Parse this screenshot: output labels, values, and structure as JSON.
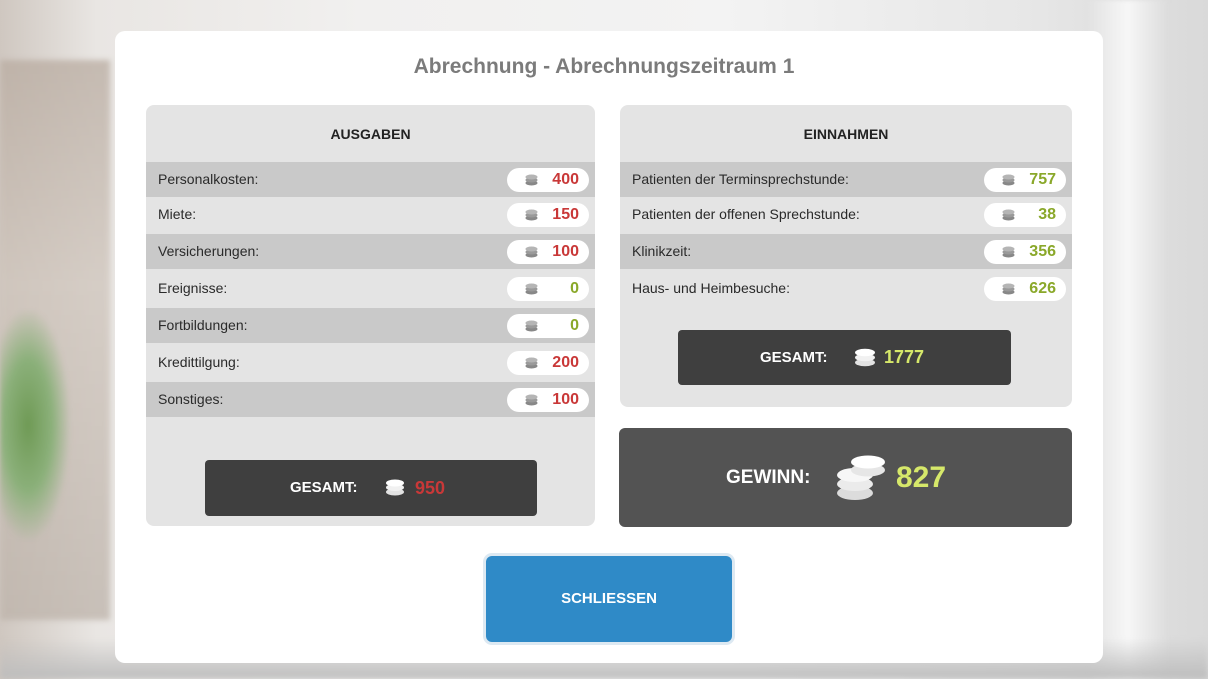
{
  "dialog": {
    "title": "Abrechnung - Abrechnungszeitraum 1",
    "close_label": "SCHLIESSEN"
  },
  "expenses": {
    "heading": "AUSGABEN",
    "items": [
      {
        "label": "Personalkosten:",
        "value": "400"
      },
      {
        "label": "Miete:",
        "value": "150"
      },
      {
        "label": "Versicherungen:",
        "value": "100"
      },
      {
        "label": "Ereignisse:",
        "value": "0"
      },
      {
        "label": "Fortbildungen:",
        "value": "0"
      },
      {
        "label": "Kredittilgung:",
        "value": "200"
      },
      {
        "label": "Sonstiges:",
        "value": "100"
      }
    ],
    "total_label": "GESAMT:",
    "total_value": "950"
  },
  "income": {
    "heading": "EINNAHMEN",
    "items": [
      {
        "label": "Patienten der Terminsprechstunde:",
        "value": "757"
      },
      {
        "label": "Patienten der offenen Sprechstunde:",
        "value": "38"
      },
      {
        "label": "Klinikzeit:",
        "value": "356"
      },
      {
        "label": "Haus- und Heimbesuche:",
        "value": "626"
      }
    ],
    "total_label": "GESAMT:",
    "total_value": "1777"
  },
  "profit": {
    "label": "GEWINN:",
    "value": "827"
  },
  "colors": {
    "negative": "#c93838",
    "positive": "#8aa82a",
    "total_positive": "#d6e86a",
    "button": "#2f8ac7"
  },
  "icons": {
    "coin": "coin-stack-icon"
  }
}
